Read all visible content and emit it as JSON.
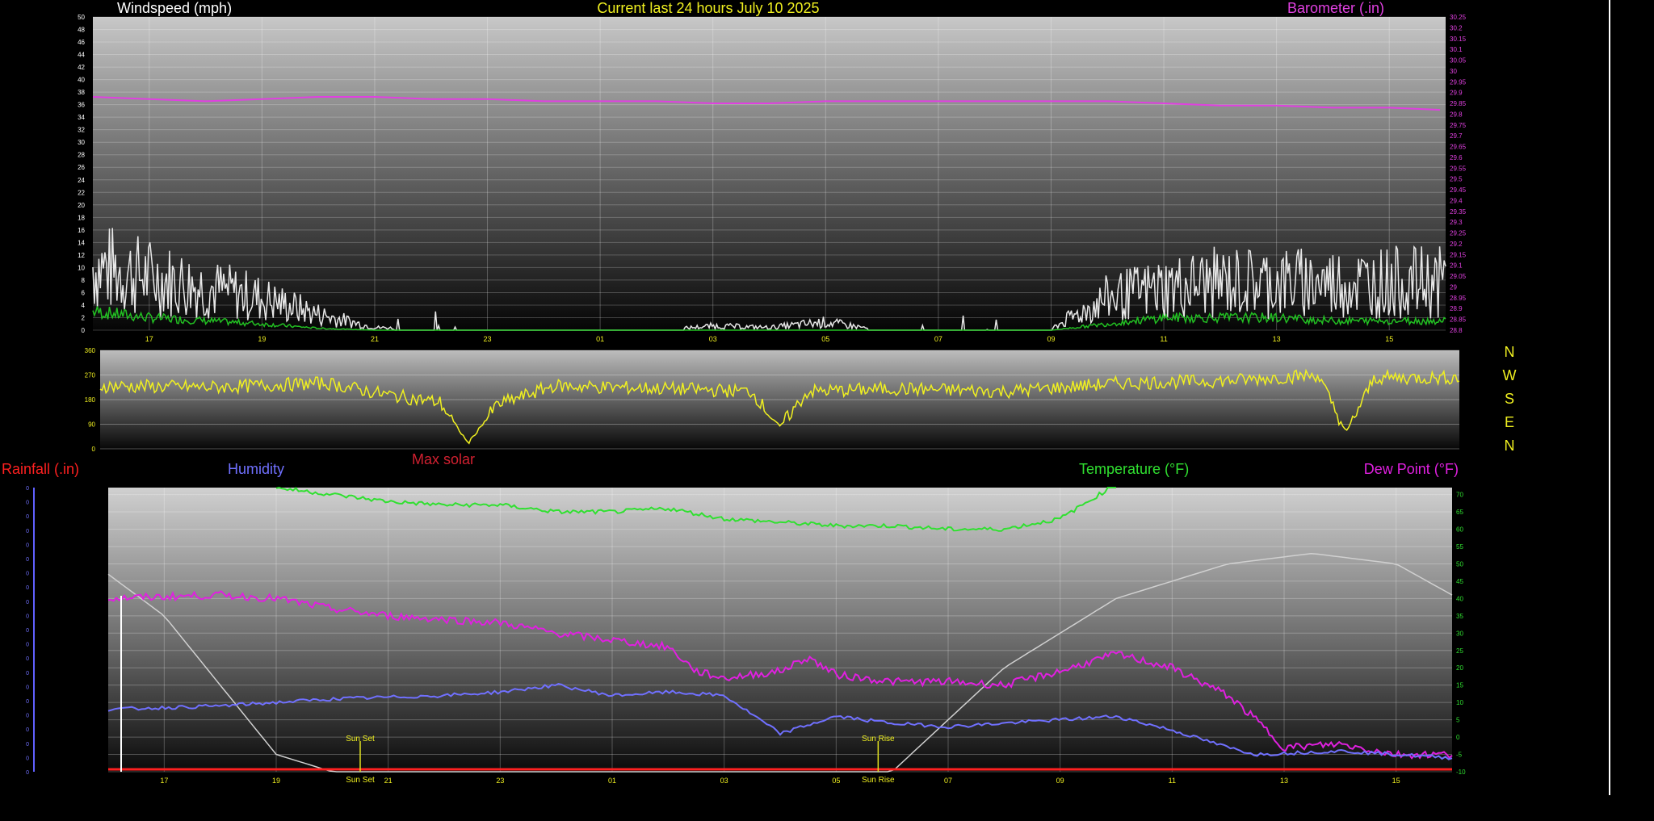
{
  "colors": {
    "speed": "#e8e8e8",
    "gust": "#22c022",
    "barometer": "#e040e0",
    "direction": "#f0f020",
    "rainfall": "#ff2020",
    "humidity": "#7070ff",
    "temperature": "#30e030",
    "dewpoint": "#e020e0",
    "solar": "#d0d0d0",
    "title": "#f0f020",
    "maxsolar": "#d02030"
  },
  "header": {
    "windspeed_label": "Windspeed (mph)",
    "title": "Current last 24 hours July 10 2025",
    "barometer_label": "Barometer (.in)"
  },
  "compass": [
    "N",
    "W",
    "S",
    "E",
    "N"
  ],
  "legend": {
    "rainfall": "Rainfall (.in)",
    "humidity": "Humidity",
    "max_solar": "Max solar",
    "temperature": "Temperature (°F)",
    "dewpoint": "Dew Point (°F)"
  },
  "sun_events": {
    "sunset_label": "Sun Set",
    "sunrise_label": "Sun Rise",
    "sunset_hour": 20.5,
    "sunrise_hour": 5.75
  },
  "chart_data": [
    {
      "type": "line",
      "name": "wind-barometer",
      "x_ticks": [
        "17",
        "19",
        "21",
        "23",
        "01",
        "03",
        "05",
        "07",
        "09",
        "11",
        "13",
        "15"
      ],
      "x_start_hour": 16.0,
      "x_span_hours": 24.0,
      "y_left_ticks": [
        0,
        2,
        4,
        6,
        8,
        10,
        12,
        14,
        16,
        18,
        20,
        22,
        24,
        26,
        28,
        30,
        32,
        34,
        36,
        38,
        40,
        42,
        44,
        46,
        48,
        50
      ],
      "y_left_range": [
        0,
        50
      ],
      "y_right_ticks": [
        "28.8",
        "28.85",
        "28.9",
        "28.95",
        "29",
        "29.05",
        "29.1",
        "29.15",
        "29.2",
        "29.25",
        "29.3",
        "29.35",
        "29.4",
        "29.45",
        "29.5",
        "29.55",
        "29.6",
        "29.65",
        "29.7",
        "29.75",
        "29.8",
        "29.85",
        "29.9",
        "29.95",
        "30",
        "30.05",
        "30.1",
        "30.15",
        "30.2",
        "30.25"
      ],
      "y_right_range": [
        28.8,
        30.25
      ],
      "barometer": [
        [
          0,
          29.88
        ],
        [
          1,
          29.87
        ],
        [
          2,
          29.86
        ],
        [
          3,
          29.87
        ],
        [
          4,
          29.88
        ],
        [
          5,
          29.88
        ],
        [
          6,
          29.87
        ],
        [
          7,
          29.87
        ],
        [
          8,
          29.86
        ],
        [
          9,
          29.86
        ],
        [
          10,
          29.86
        ],
        [
          11,
          29.85
        ],
        [
          12,
          29.85
        ],
        [
          13,
          29.86
        ],
        [
          14,
          29.86
        ],
        [
          15,
          29.86
        ],
        [
          16,
          29.86
        ],
        [
          17,
          29.86
        ],
        [
          18,
          29.86
        ],
        [
          19,
          29.85
        ],
        [
          20,
          29.84
        ],
        [
          21,
          29.84
        ],
        [
          22,
          29.83
        ],
        [
          23,
          29.83
        ],
        [
          23.9,
          29.82
        ]
      ],
      "wind_levels": [
        [
          0,
          12
        ],
        [
          1,
          10
        ],
        [
          2,
          8
        ],
        [
          3,
          6
        ],
        [
          4,
          3
        ],
        [
          5,
          0.5
        ],
        [
          6,
          0.2
        ],
        [
          7,
          0
        ],
        [
          8,
          0
        ],
        [
          9,
          0
        ],
        [
          10,
          0
        ],
        [
          11,
          0.8
        ],
        [
          12,
          0.5
        ],
        [
          13,
          1.5
        ],
        [
          14,
          0
        ],
        [
          15,
          0
        ],
        [
          16,
          0
        ],
        [
          17,
          0.3
        ],
        [
          18,
          6
        ],
        [
          19,
          8
        ],
        [
          20,
          9
        ],
        [
          21,
          9
        ],
        [
          22,
          9
        ],
        [
          23,
          9
        ],
        [
          24,
          9
        ]
      ],
      "gust_levels": [
        [
          0,
          3
        ],
        [
          1,
          2
        ],
        [
          2,
          1.5
        ],
        [
          3,
          1
        ],
        [
          4,
          0.3
        ],
        [
          5,
          0
        ],
        [
          17,
          0
        ],
        [
          18,
          1
        ],
        [
          19,
          2
        ],
        [
          20,
          2
        ],
        [
          21,
          2
        ],
        [
          22,
          1.5
        ],
        [
          23,
          1.5
        ],
        [
          24,
          1.5
        ]
      ]
    },
    {
      "type": "line",
      "name": "wind-direction",
      "y_ticks": [
        0,
        90,
        180,
        270,
        360
      ],
      "y_range": [
        0,
        360
      ],
      "direction_levels": [
        [
          0,
          230
        ],
        [
          2,
          225
        ],
        [
          4,
          240
        ],
        [
          5,
          200
        ],
        [
          6,
          170
        ],
        [
          6.5,
          20
        ],
        [
          7,
          160
        ],
        [
          8,
          230
        ],
        [
          10,
          220
        ],
        [
          11.5,
          210
        ],
        [
          12,
          80
        ],
        [
          12.5,
          210
        ],
        [
          14,
          220
        ],
        [
          16,
          210
        ],
        [
          18,
          240
        ],
        [
          20,
          250
        ],
        [
          21.5,
          270
        ],
        [
          22,
          60
        ],
        [
          22.5,
          260
        ],
        [
          24,
          260
        ]
      ]
    },
    {
      "type": "line",
      "name": "temp-humidity-dewpoint",
      "x_ticks": [
        "17",
        "19",
        "21",
        "23",
        "01",
        "03",
        "05",
        "07",
        "09",
        "11",
        "13",
        "15"
      ],
      "y_right_ticks": [
        -10,
        -5,
        0,
        5,
        10,
        15,
        20,
        25,
        30,
        35,
        40,
        45,
        50,
        55,
        60,
        65,
        70
      ],
      "y_right_range": [
        -10,
        72
      ],
      "temperature": [
        [
          3,
          72
        ],
        [
          4,
          70
        ],
        [
          5,
          68
        ],
        [
          6,
          67
        ],
        [
          7,
          67
        ],
        [
          8,
          65
        ],
        [
          9,
          65
        ],
        [
          10,
          66
        ],
        [
          11,
          63
        ],
        [
          12,
          62
        ],
        [
          13,
          61
        ],
        [
          14,
          61
        ],
        [
          15,
          60
        ],
        [
          16,
          60
        ],
        [
          17,
          63
        ],
        [
          17.5,
          68
        ],
        [
          18,
          73
        ]
      ],
      "dewpoint": [
        [
          0,
          40
        ],
        [
          2,
          41
        ],
        [
          3,
          40
        ],
        [
          4,
          37
        ],
        [
          5,
          35
        ],
        [
          6,
          34
        ],
        [
          7,
          33
        ],
        [
          8,
          30
        ],
        [
          9,
          28
        ],
        [
          10,
          26
        ],
        [
          10.5,
          19
        ],
        [
          11,
          17
        ],
        [
          12,
          19
        ],
        [
          12.5,
          23
        ],
        [
          13,
          18
        ],
        [
          14,
          16
        ],
        [
          15,
          16
        ],
        [
          16,
          15
        ],
        [
          17,
          19
        ],
        [
          18,
          24
        ],
        [
          19,
          20
        ],
        [
          20,
          12
        ],
        [
          20.5,
          5
        ],
        [
          21,
          -3
        ],
        [
          22,
          -2
        ],
        [
          23,
          -5
        ],
        [
          24,
          -5
        ]
      ],
      "humidity": [
        [
          0,
          8
        ],
        [
          2,
          9
        ],
        [
          4,
          11
        ],
        [
          6,
          12
        ],
        [
          7,
          13
        ],
        [
          8,
          15
        ],
        [
          9,
          12
        ],
        [
          10,
          13
        ],
        [
          11,
          12
        ],
        [
          12,
          1
        ],
        [
          13,
          6
        ],
        [
          14,
          4
        ],
        [
          15,
          3
        ],
        [
          16,
          4
        ],
        [
          17,
          5
        ],
        [
          18,
          6
        ],
        [
          19,
          2
        ],
        [
          20,
          -3
        ],
        [
          20.5,
          -5
        ],
        [
          22,
          -4
        ],
        [
          24,
          -6
        ]
      ],
      "max_solar": [
        [
          0,
          47
        ],
        [
          1,
          35
        ],
        [
          2,
          15
        ],
        [
          3,
          -5
        ],
        [
          4,
          -10
        ],
        [
          14,
          -10
        ],
        [
          15,
          5
        ],
        [
          16,
          20
        ],
        [
          18,
          40
        ],
        [
          20,
          50
        ],
        [
          21.5,
          53
        ],
        [
          23,
          50
        ],
        [
          24,
          41
        ]
      ]
    }
  ]
}
